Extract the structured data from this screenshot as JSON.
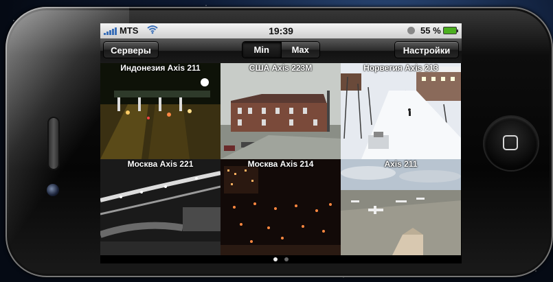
{
  "status_bar": {
    "carrier": "MTS",
    "time": "19:39",
    "battery_percent": "55 %"
  },
  "nav": {
    "servers_label": "Серверы",
    "segment_min": "Min",
    "segment_max": "Max",
    "settings_label": "Настройки"
  },
  "cameras": [
    {
      "title": "Индонезия Axis 211"
    },
    {
      "title": "США Axis 223M"
    },
    {
      "title": "Норвегия Axis 213"
    },
    {
      "title": "Москва Axis 221"
    },
    {
      "title": "Москва Axis 214"
    },
    {
      "title": "Axis 211"
    }
  ],
  "pager": {
    "pages": 2,
    "current": 1
  },
  "colors": {
    "battery": "#4caf20",
    "signal": "#3a6fb8"
  }
}
